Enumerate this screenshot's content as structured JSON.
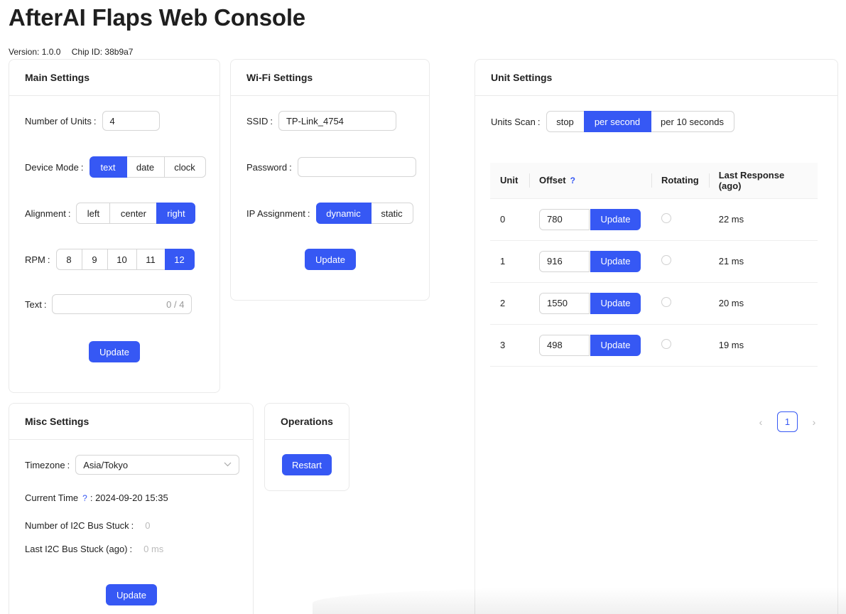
{
  "header": {
    "title": "AfterAI Flaps Web Console",
    "version": "Version: 1.0.0",
    "chip_id": "Chip ID: 38b9a7"
  },
  "main_settings": {
    "title": "Main Settings",
    "units_label": "Number of Units",
    "units_value": "4",
    "mode_label": "Device Mode",
    "mode_options": [
      "text",
      "date",
      "clock"
    ],
    "mode_selected": "text",
    "alignment_label": "Alignment",
    "alignment_options": [
      "left",
      "center",
      "right"
    ],
    "alignment_selected": "right",
    "rpm_label": "RPM",
    "rpm_options": [
      "8",
      "9",
      "10",
      "11",
      "12"
    ],
    "rpm_selected": "12",
    "text_label": "Text",
    "text_value": "",
    "text_count": "0 / 4",
    "update_label": "Update"
  },
  "wifi_settings": {
    "title": "Wi-Fi Settings",
    "ssid_label": "SSID",
    "ssid_value": "TP-Link_4754",
    "password_label": "Password",
    "password_value": "",
    "ip_label": "IP Assignment",
    "ip_options": [
      "dynamic",
      "static"
    ],
    "ip_selected": "dynamic",
    "update_label": "Update"
  },
  "unit_settings": {
    "title": "Unit Settings",
    "scan_label": "Units Scan",
    "scan_options": [
      "stop",
      "per second",
      "per 10 seconds"
    ],
    "scan_selected": "per second",
    "columns": [
      "Unit",
      "Offset",
      "Rotating",
      "Last Response (ago)"
    ],
    "offset_help": "?",
    "rows": [
      {
        "unit": "0",
        "offset": "780",
        "update": "Update",
        "rotating": false,
        "last": "22 ms"
      },
      {
        "unit": "1",
        "offset": "916",
        "update": "Update",
        "rotating": false,
        "last": "21 ms"
      },
      {
        "unit": "2",
        "offset": "1550",
        "update": "Update",
        "rotating": false,
        "last": "20 ms"
      },
      {
        "unit": "3",
        "offset": "498",
        "update": "Update",
        "rotating": false,
        "last": "19 ms"
      }
    ],
    "pagination": {
      "current": "1",
      "prev": "‹",
      "next": "›"
    }
  },
  "misc_settings": {
    "title": "Misc Settings",
    "timezone_label": "Timezone",
    "timezone_value": "Asia/Tokyo",
    "time_label": "Current Time",
    "time_help": "?",
    "time_value": "2024-09-20 15:35",
    "i2c_label": "Number of I2C Bus Stuck",
    "i2c_value": "0",
    "last_i2c_label": "Last I2C Bus Stuck (ago)",
    "last_i2c_value": "0 ms",
    "update_label": "Update"
  },
  "operations": {
    "title": "Operations",
    "restart_label": "Restart"
  },
  "colors": {
    "accent": "#3658f4"
  },
  "icons": {
    "chevron": "chevron-down-icon",
    "prev": "chevron-left-icon",
    "next": "chevron-right-icon"
  }
}
